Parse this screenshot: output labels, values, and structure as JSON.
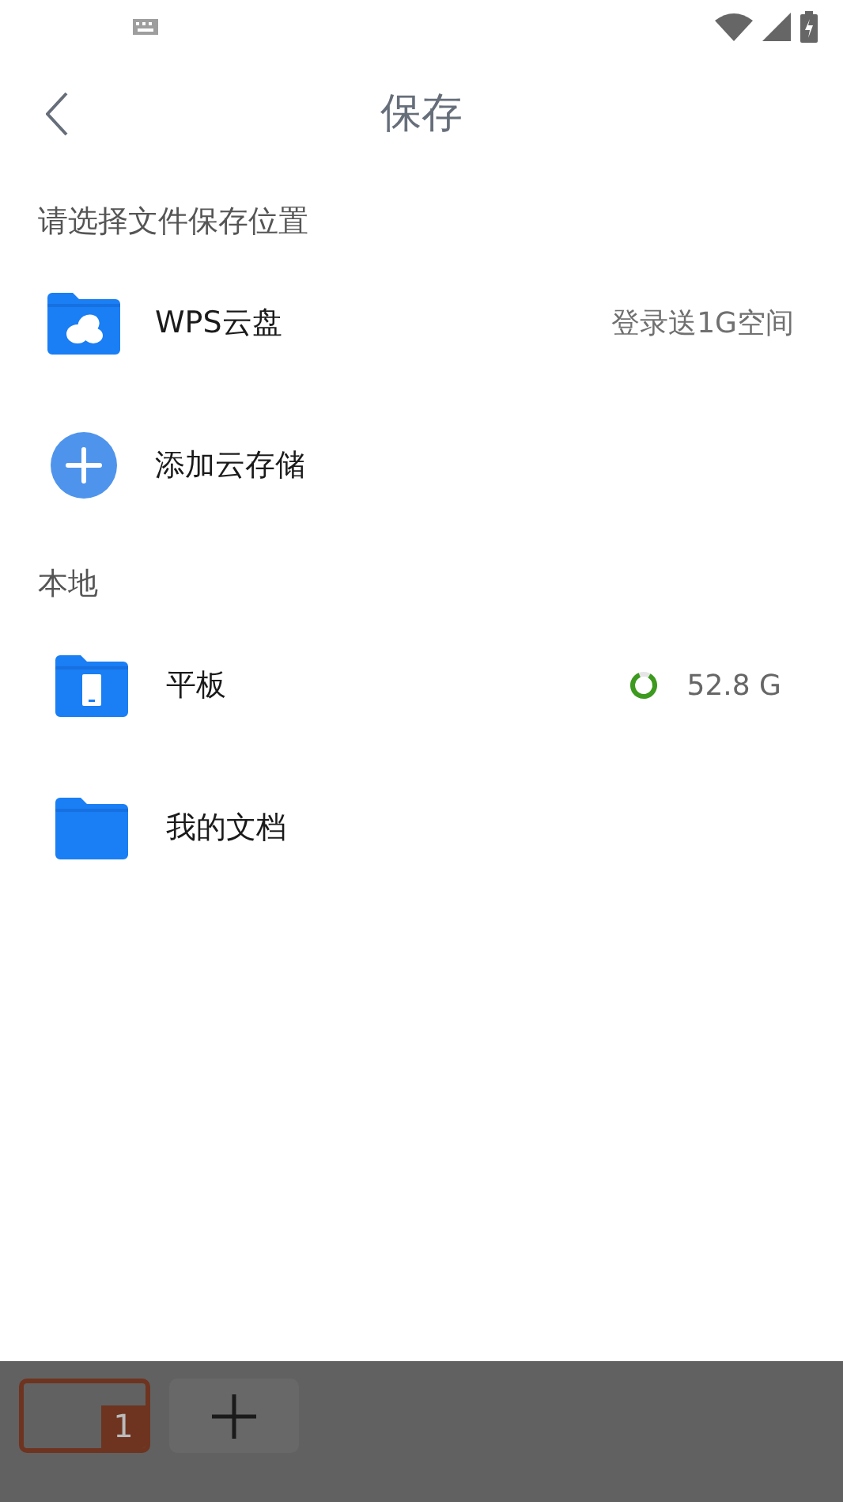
{
  "header": {
    "title": "保存"
  },
  "sections": [
    {
      "heading": "请选择文件保存位置",
      "items": [
        {
          "kind": "cloud",
          "label": "WPS云盘",
          "note": "登录送1G空间"
        },
        {
          "kind": "add",
          "label": "添加云存储"
        }
      ]
    },
    {
      "heading": "本地",
      "items": [
        {
          "kind": "device",
          "label": "平板",
          "usage": {
            "reading": "52.8 G"
          }
        },
        {
          "kind": "folder",
          "label": "我的文档"
        }
      ]
    }
  ],
  "bottom_bar": {
    "tabs": [
      {
        "count": "1",
        "selected": true
      }
    ]
  }
}
